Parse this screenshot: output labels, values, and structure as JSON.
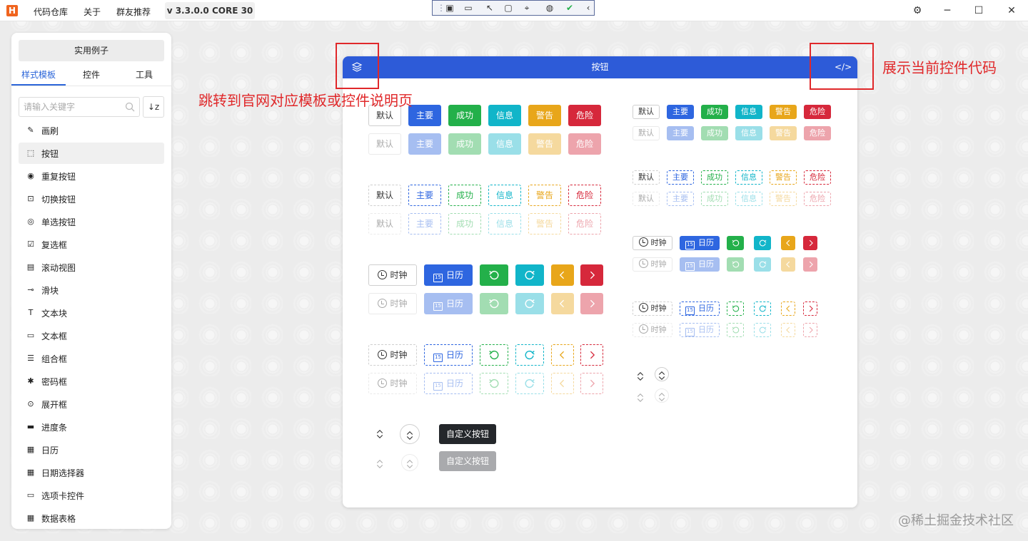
{
  "titlebar": {
    "logo_letter": "H",
    "menu": [
      "代码仓库",
      "关于",
      "群友推荐"
    ],
    "version": "v 3.3.0.0 CORE 30",
    "window_controls": {
      "min": "─",
      "max": "☐",
      "close": "✕"
    }
  },
  "sidebar": {
    "examples_button": "实用例子",
    "tabs": [
      "样式模板",
      "控件",
      "工具"
    ],
    "search_placeholder": "请输入关键字",
    "sort_icon": "↓z",
    "items": [
      {
        "label": "画刷",
        "icon": "brush-icon"
      },
      {
        "label": "按钮",
        "icon": "button-icon",
        "active": true
      },
      {
        "label": "重复按钮",
        "icon": "repeat-button-icon"
      },
      {
        "label": "切换按钮",
        "icon": "toggle-button-icon"
      },
      {
        "label": "单选按钮",
        "icon": "radio-icon"
      },
      {
        "label": "复选框",
        "icon": "checkbox-icon"
      },
      {
        "label": "滚动视图",
        "icon": "scrollview-icon"
      },
      {
        "label": "滑块",
        "icon": "slider-icon"
      },
      {
        "label": "文本块",
        "icon": "textblock-icon"
      },
      {
        "label": "文本框",
        "icon": "textbox-icon"
      },
      {
        "label": "组合框",
        "icon": "combobox-icon"
      },
      {
        "label": "密码框",
        "icon": "passwordbox-icon"
      },
      {
        "label": "展开框",
        "icon": "expander-icon"
      },
      {
        "label": "进度条",
        "icon": "progressbar-icon"
      },
      {
        "label": "日历",
        "icon": "calendar-icon"
      },
      {
        "label": "日期选择器",
        "icon": "datepicker-icon"
      },
      {
        "label": "选项卡控件",
        "icon": "tabcontrol-icon"
      },
      {
        "label": "数据表格",
        "icon": "datagrid-icon"
      }
    ]
  },
  "card": {
    "title": "按钮",
    "variant_labels": [
      "默认",
      "主要",
      "成功",
      "信息",
      "警告",
      "危险"
    ],
    "clock_label": "时钟",
    "calendar_label": "日历",
    "calendar_day": "15",
    "custom_button_label": "自定义按钮"
  },
  "annotations": {
    "left": "跳转到官网对应模板或控件说明页",
    "right": "展示当前控件代码"
  },
  "watermark": "@稀土掘金技术社区",
  "colors": {
    "primary": "#2e66e0",
    "success": "#23b04a",
    "info": "#11b5c9",
    "warning": "#e8a61a",
    "danger": "#d6283b",
    "header": "#2d5bd8",
    "annotation": "#e0282a"
  }
}
